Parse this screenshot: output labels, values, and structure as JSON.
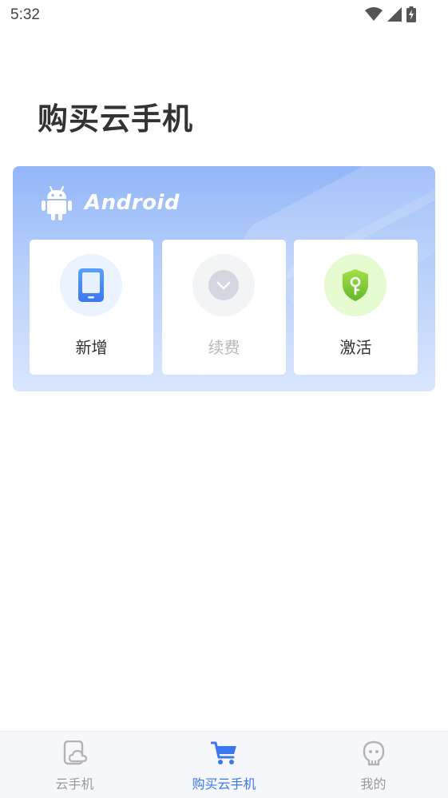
{
  "status_bar": {
    "time": "5:32"
  },
  "page": {
    "title": "购买云手机"
  },
  "card": {
    "brand": "Android",
    "tiles": [
      {
        "label": "新增",
        "icon": "phone-icon",
        "enabled": true
      },
      {
        "label": "续费",
        "icon": "chevron-down-icon",
        "enabled": false
      },
      {
        "label": "激活",
        "icon": "shield-key-icon",
        "enabled": true
      }
    ]
  },
  "bottom_nav": {
    "items": [
      {
        "label": "云手机",
        "icon": "cloud-phone-icon",
        "active": false
      },
      {
        "label": "购买云手机",
        "icon": "cart-icon",
        "active": true
      },
      {
        "label": "我的",
        "icon": "profile-icon",
        "active": false
      }
    ]
  },
  "colors": {
    "accent": "#3b78f0",
    "card_top": "#93b6f8",
    "card_bottom": "#dae6fd",
    "activate_green": "#7ccc2c"
  }
}
